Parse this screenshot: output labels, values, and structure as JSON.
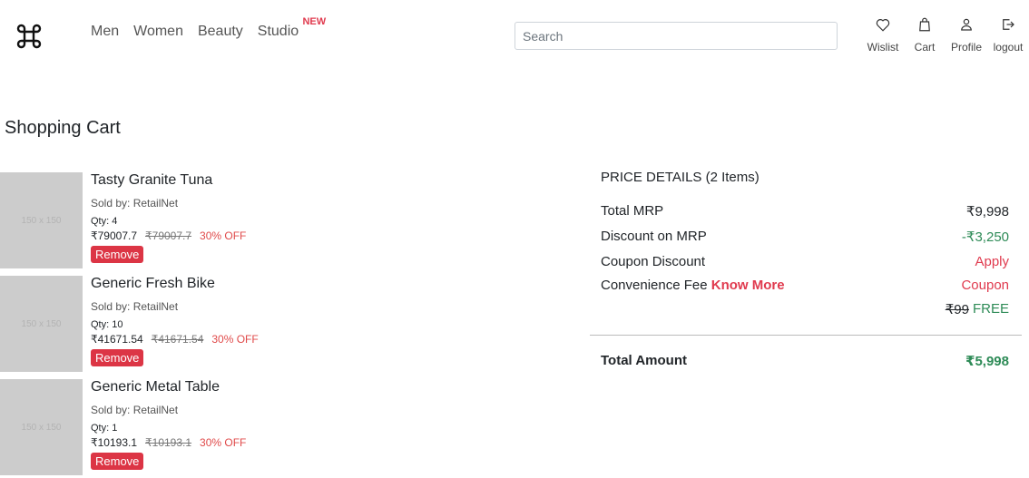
{
  "header": {
    "logo_icon": "command-key-icon",
    "nav": [
      {
        "label": "Men"
      },
      {
        "label": "Women"
      },
      {
        "label": "Beauty"
      },
      {
        "label": "Studio",
        "badge": "NEW"
      }
    ],
    "search_placeholder": "Search",
    "icons": [
      {
        "label": "Wislist",
        "icon": "heart-icon"
      },
      {
        "label": "Cart",
        "icon": "bag-icon"
      },
      {
        "label": "Profile",
        "icon": "user-icon"
      },
      {
        "label": "logout",
        "icon": "logout-icon"
      }
    ]
  },
  "page_title": "Shopping Cart",
  "cart": {
    "items": [
      {
        "placeholder": "150 x 150",
        "name": "Tasty Granite Tuna",
        "seller": "Sold by: RetailNet",
        "qty": "Qty: 4",
        "price": "₹79007.7",
        "mrp": "₹79007.7",
        "off": "30% OFF",
        "remove_label": "Remove"
      },
      {
        "placeholder": "150 x 150",
        "name": "Generic Fresh Bike",
        "seller": "Sold by: RetailNet",
        "qty": "Qty: 10",
        "price": "₹41671.54",
        "mrp": "₹41671.54",
        "off": "30% OFF",
        "remove_label": "Remove"
      },
      {
        "placeholder": "150 x 150",
        "name": "Generic Metal Table",
        "seller": "Sold by: RetailNet",
        "qty": "Qty: 1",
        "price": "₹10193.1",
        "mrp": "₹10193.1",
        "off": "30% OFF",
        "remove_label": "Remove"
      }
    ]
  },
  "price_details": {
    "title": "PRICE DETAILS (2 Items)",
    "total_mrp_label": "Total MRP",
    "total_mrp_value": "₹9,998",
    "discount_label": "Discount on MRP",
    "discount_value": "-₹3,250",
    "coupon_label": "Coupon Discount",
    "coupon_value": "Apply",
    "fee_label": "Convenience Fee",
    "fee_link": "Know More",
    "fee_value_coupon": "Coupon",
    "fee_old": "₹99",
    "fee_free": "FREE",
    "total_label": "Total Amount",
    "total_value": "₹5,998"
  },
  "colors": {
    "accent_red": "#e03a4e",
    "remove_button": "#dc3545",
    "green": "#2e8b57"
  }
}
